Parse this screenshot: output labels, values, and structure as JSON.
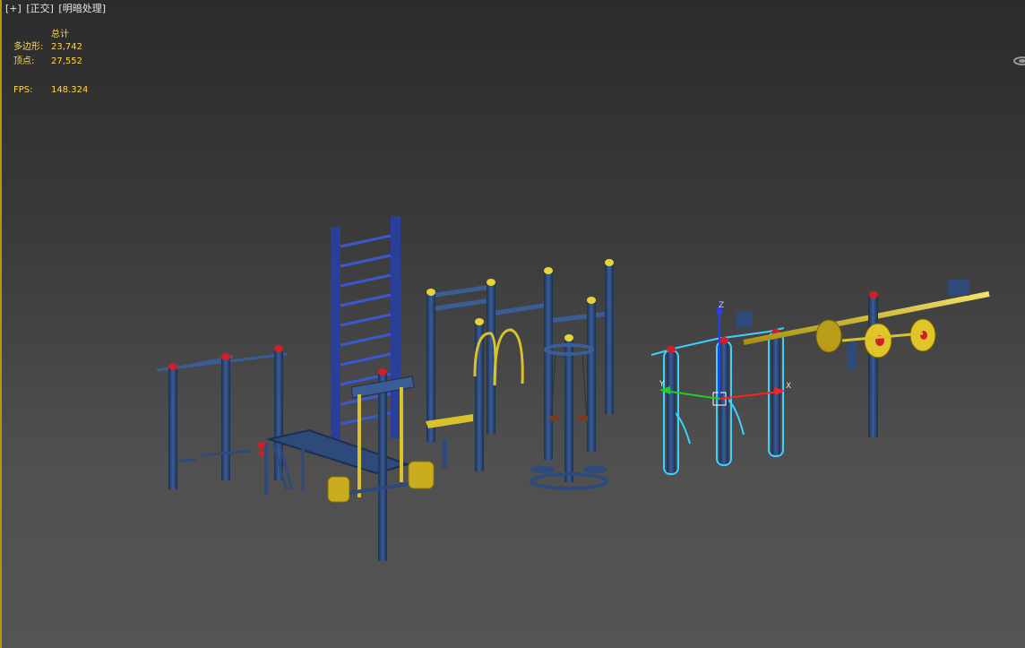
{
  "viewport_labels": {
    "plus": "[+]",
    "view": "[正交]",
    "shading": "[明暗处理]"
  },
  "stats": {
    "header": "总计",
    "polygons_label": "多边形:",
    "polygons_value": "23,742",
    "vertices_label": "顶点:",
    "vertices_value": "27,552",
    "fps_label": "FPS:",
    "fps_value": "148.324"
  },
  "gizmo_axes": {
    "x": "X",
    "y": "Y",
    "z": "Z"
  },
  "colors": {
    "frame": "#b8960c",
    "stats_text": "#ffd64f",
    "equipment_blue": "#2e4a7a",
    "equipment_yellow": "#d9c22a",
    "cap_red": "#d11f2a",
    "cap_yellow": "#e6d33b",
    "selection": "#3fd0ff",
    "axis_x": "#ff2020",
    "axis_y": "#20d020",
    "axis_z": "#2040ff"
  }
}
